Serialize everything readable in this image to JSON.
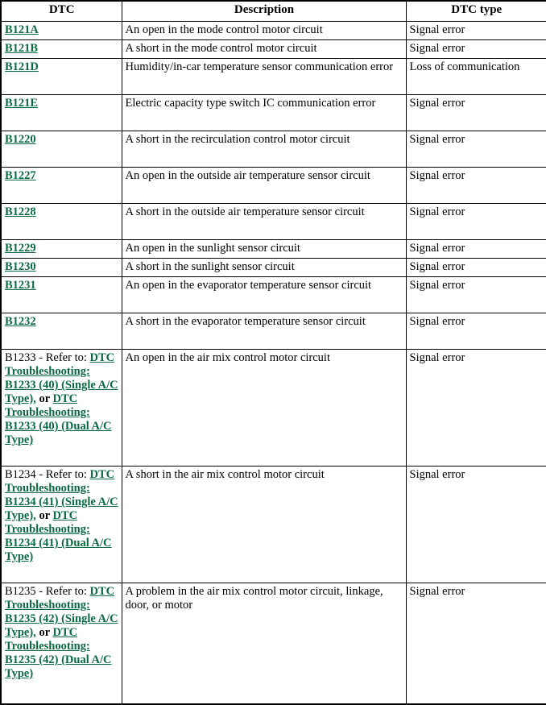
{
  "table": {
    "columns": [
      "DTC",
      "Description",
      "DTC type"
    ],
    "rows": [
      {
        "dtc": "B121A",
        "dtc_kind": "link",
        "description": "An open in the mode control motor circuit",
        "type": "Signal error"
      },
      {
        "dtc": "B121B",
        "dtc_kind": "link",
        "description": "A short in the mode control motor circuit",
        "type": "Signal error"
      },
      {
        "dtc": "B121D",
        "dtc_kind": "link",
        "description": "Humidity/in-car temperature sensor communication error",
        "type": "Loss of communication"
      },
      {
        "dtc": "B121E",
        "dtc_kind": "link",
        "description": "Electric capacity type switch IC communication error",
        "type": "Signal error"
      },
      {
        "dtc": "B1220",
        "dtc_kind": "link",
        "description": "A short in the recirculation control motor circuit",
        "type": "Signal error"
      },
      {
        "dtc": "B1227",
        "dtc_kind": "link",
        "description": "An open in the outside air temperature sensor circuit",
        "type": "Signal error"
      },
      {
        "dtc": "B1228",
        "dtc_kind": "link",
        "description": "A short in the outside air temperature sensor circuit",
        "type": "Signal error"
      },
      {
        "dtc": "B1229",
        "dtc_kind": "link",
        "description": "An open in the sunlight sensor circuit",
        "type": "Signal error"
      },
      {
        "dtc": "B1230",
        "dtc_kind": "link",
        "description": "A short in the sunlight sensor circuit",
        "type": "Signal error"
      },
      {
        "dtc": "B1231",
        "dtc_kind": "link",
        "description": "An open in the evaporator temperature sensor circuit",
        "type": "Signal error"
      },
      {
        "dtc": "B1232",
        "dtc_kind": "link",
        "description": "A short in the evaporator temperature sensor circuit",
        "type": "Signal error"
      },
      {
        "dtc_kind": "reference",
        "ref_prefix": "B1233 - Refer to:",
        "ref_link_1": "DTC Troubleshooting: B1233 (40) (Single A/C Type),",
        "ref_conj": " or ",
        "ref_link_2": "DTC Troubleshooting: B1233 (40) (Dual A/C Type)",
        "description": "An open in the air mix control motor circuit",
        "type": "Signal error"
      },
      {
        "dtc_kind": "reference",
        "ref_prefix": "B1234 - Refer to:",
        "ref_link_1": "DTC Troubleshooting: B1234 (41) (Single A/C Type),",
        "ref_conj": " or ",
        "ref_link_2": "DTC Troubleshooting: B1234 (41) (Dual A/C Type)",
        "description": "A short in the air mix control motor circuit",
        "type": "Signal error"
      },
      {
        "dtc_kind": "reference",
        "ref_prefix": "B1235 - Refer to:",
        "ref_link_1": "DTC Troubleshooting: B1235 (42) (Single A/C Type),",
        "ref_conj": " or ",
        "ref_link_2": "DTC Troubleshooting: B1235 (42) (Dual A/C Type)",
        "description": "A problem in the air mix control motor circuit, linkage, door, or motor",
        "type": "Signal error"
      }
    ]
  },
  "colors": {
    "link_green": "#0a6b42",
    "text_black": "#000000",
    "border_black": "#000000",
    "background": "#ffffff"
  }
}
